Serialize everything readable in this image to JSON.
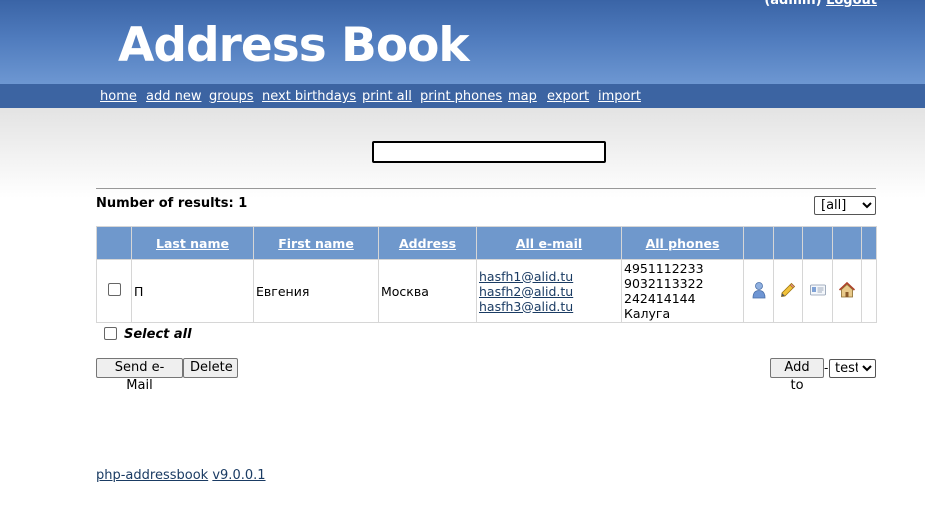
{
  "header": {
    "login_prefix": "(admin)",
    "logout_label": "Logout",
    "logo_text": "Address Book"
  },
  "nav": {
    "items": [
      "home",
      "add new",
      "groups",
      "next birthdays",
      "print all",
      "print phones",
      "map",
      "export",
      "import"
    ]
  },
  "search": {
    "value": ""
  },
  "results": {
    "label": "Number of results: 1",
    "group_filter": "[all]"
  },
  "table": {
    "headers": [
      "Last name",
      "First name",
      "Address",
      "All e-mail",
      "All phones"
    ],
    "rows": [
      {
        "last_name": "П",
        "first_name": "Евгения",
        "address": "Москва",
        "emails": [
          "hasfh1@alid.tu",
          "hasfh2@alid.tu",
          "hasfh3@alid.tu"
        ],
        "phones": [
          "4951112233",
          "9032113322",
          "242414144",
          "Калуга"
        ],
        "icons": [
          "details-icon",
          "edit-icon",
          "vcard-icon",
          "home-icon"
        ]
      }
    ]
  },
  "select_all_label": "Select all",
  "buttons": {
    "send_email": "Send e-Mail",
    "delete": "Delete",
    "add_to": "Add to",
    "separator": "-",
    "add_to_group": "test"
  },
  "footer": {
    "app_name": "php-addressbook",
    "version": "v9.0.0.1"
  },
  "colors": {
    "header": "#4f7bbd",
    "nav": "#3c64a2",
    "table_header": "#6f98cc",
    "link": "#1a3b63"
  }
}
